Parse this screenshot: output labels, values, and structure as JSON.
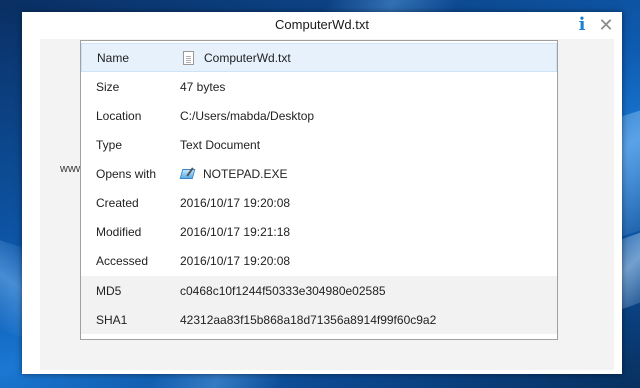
{
  "window": {
    "title": "ComputerWd.txt",
    "info_icon": "info-icon",
    "close_icon": "close-icon"
  },
  "watermark": "www.computer-wd.com",
  "properties": [
    {
      "label": "Name",
      "value": "ComputerWd.txt",
      "icon": "text-file-icon"
    },
    {
      "label": "Size",
      "value": "47 bytes"
    },
    {
      "label": "Location",
      "value": "C:/Users/mabda/Desktop"
    },
    {
      "label": "Type",
      "value": "Text Document"
    },
    {
      "label": "Opens with",
      "value": "NOTEPAD.EXE",
      "icon": "notepad-icon"
    },
    {
      "label": "Created",
      "value": "2016/10/17 19:20:08"
    },
    {
      "label": "Modified",
      "value": "2016/10/17 19:21:18"
    },
    {
      "label": "Accessed",
      "value": "2016/10/17 19:20:08"
    },
    {
      "label": "MD5",
      "value": "c0468c10f1244f50333e304980e02585"
    },
    {
      "label": "SHA1",
      "value": "42312aa83f15b868a18d71356a8914f99f60c9a2"
    }
  ],
  "colors": {
    "accent": "#1e7fd6",
    "selected_row": "#e6f1fb",
    "hash_row": "#f2f2f2"
  }
}
